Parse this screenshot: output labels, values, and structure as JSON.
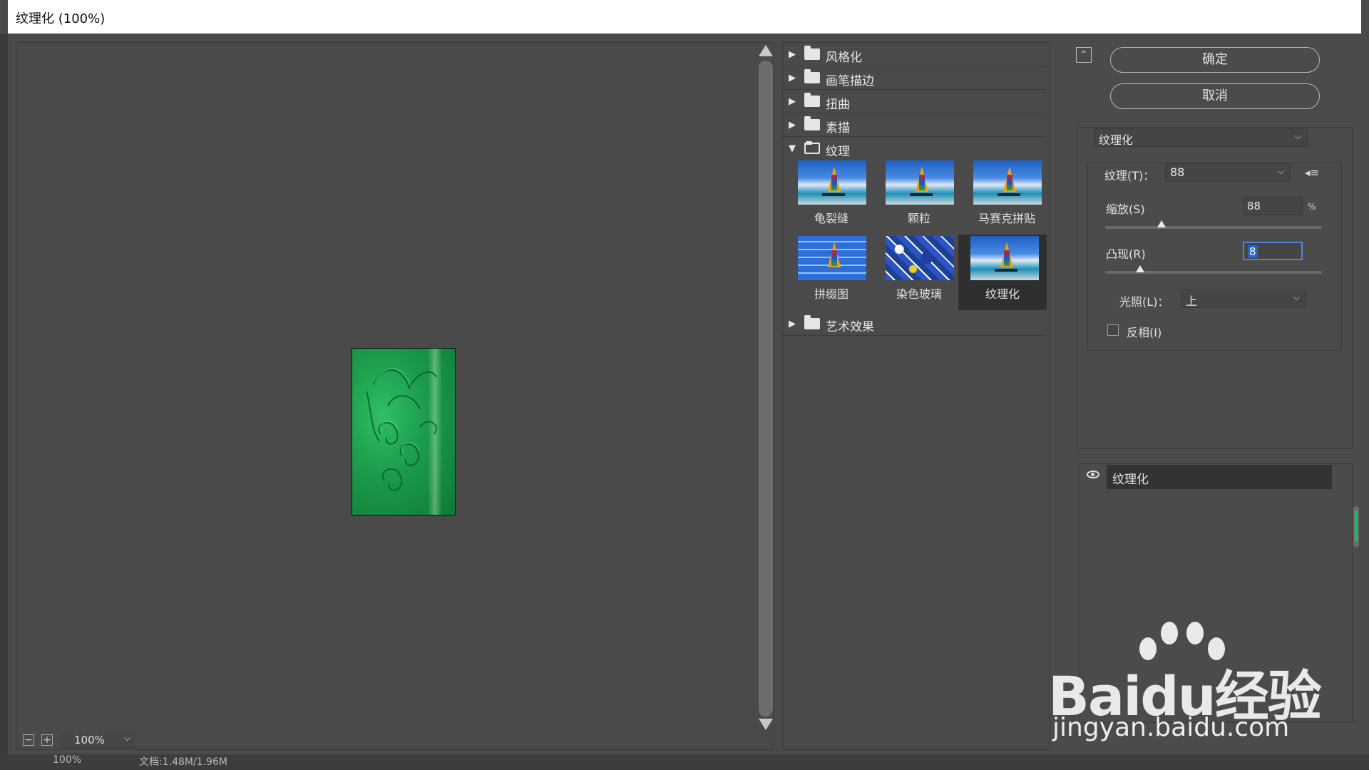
{
  "window": {
    "title": "纹理化 (100%)"
  },
  "preview": {
    "zoom_level": "100%",
    "zoom_out_icon": "minus-icon",
    "zoom_in_icon": "plus-icon"
  },
  "gallery": {
    "categories_top": [
      "风格化",
      "画笔描边",
      "扭曲",
      "素描"
    ],
    "open_category": "纹理",
    "thumbnails": [
      {
        "name": "龟裂缝"
      },
      {
        "name": "颗粒"
      },
      {
        "name": "马赛克拼贴"
      },
      {
        "name": "拼缀图"
      },
      {
        "name": "染色玻璃"
      },
      {
        "name": "纹理化",
        "selected": true
      }
    ],
    "categories_bottom": [
      "艺术效果"
    ]
  },
  "buttons": {
    "ok": "确定",
    "cancel": "取消"
  },
  "filter_select": {
    "value": "纹理化"
  },
  "params": {
    "texture_label": "纹理(T)：",
    "texture_value": "88",
    "scaling_label": "缩放(S)",
    "scaling_value": "88",
    "scaling_unit": "%",
    "scaling_level": 0.26,
    "relief_label": "凸现(R)",
    "relief_value": "8",
    "relief_level": 0.16,
    "light_label": "光照(L)：",
    "light_value": "上",
    "invert_label": "反相(I)",
    "invert_checked": false
  },
  "layers": {
    "items": [
      {
        "name": "纹理化",
        "visible": true
      }
    ]
  },
  "statusbar": {
    "zoom": "100%",
    "doc": "文档:1.48M/1.96M"
  },
  "watermark": {
    "brand": "Baidu经验",
    "url": "jingyan.baidu.com"
  },
  "colors": {
    "panel_bg": "#4b4b4b",
    "selection": "#2f2f2f",
    "focus_blue": "#4c85e0",
    "accent_green": "#1fb86a"
  }
}
